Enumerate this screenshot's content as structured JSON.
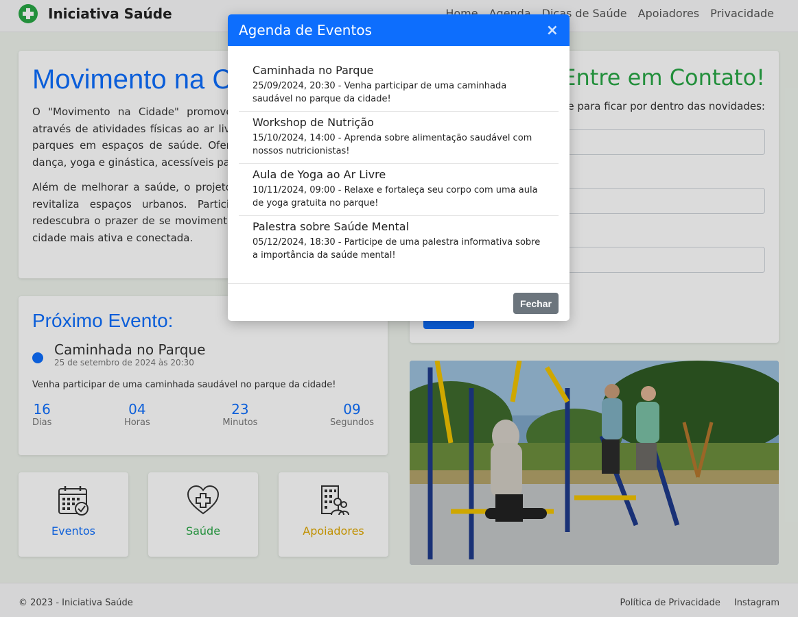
{
  "navbar": {
    "brand": "Iniciativa Saúde",
    "links": [
      "Home",
      "Agenda",
      "Dicas de Saúde",
      "Apoiadores",
      "Privacidade"
    ]
  },
  "about": {
    "title": "Movimento na Cidade",
    "paragraph1": "O \"Movimento na Cidade\" promove a saúde e o bem-estar através de atividades físicas ao ar livre, transformando praças e parques em espaços de saúde. Oferecemos aulas gratuitas de dança, yoga e ginástica, acessíveis para todas as idades.",
    "paragraph2": "Além de melhorar a saúde, o projeto fortalece a comunidade e revitaliza espaços urbanos. Participe, traga sua família e redescubra o prazer de se movimentar! Juntos, vamos criar uma cidade mais ativa e conectada."
  },
  "contact": {
    "title": "Entre em Contato!",
    "lead": "Cadastre-se para ficar por dentro das novidades:"
  },
  "next_event": {
    "heading": "Próximo Evento:",
    "title": "Caminhada no Parque",
    "date": "25 de setembro de 2024 às 20:30",
    "description": "Venha participar de uma caminhada saudável no parque da cidade!",
    "countdown": [
      {
        "value": "16",
        "label": "Dias"
      },
      {
        "value": "04",
        "label": "Horas"
      },
      {
        "value": "23",
        "label": "Minutos"
      },
      {
        "value": "09",
        "label": "Segundos"
      }
    ]
  },
  "tiles": [
    {
      "label": "Eventos",
      "icon": "calendar-check-icon",
      "color": "#0d6efd"
    },
    {
      "label": "Saúde",
      "icon": "heart-plus-icon",
      "color": "#28a745"
    },
    {
      "label": "Apoiadores",
      "icon": "building-people-icon",
      "color": "#e0a800"
    }
  ],
  "footer": {
    "copyright": "© 2023 - Iniciativa Saúde",
    "links": [
      "Política de Privacidade",
      "Instagram"
    ]
  },
  "modal": {
    "title": "Agenda de Eventos",
    "close_icon": "×",
    "events": [
      {
        "title": "Caminhada no Parque",
        "text": "25/09/2024, 20:30 - Venha participar de uma caminhada saudável no parque da cidade!"
      },
      {
        "title": "Workshop de Nutrição",
        "text": "15/10/2024, 14:00 - Aprenda sobre alimentação saudável com nossos nutricionistas!"
      },
      {
        "title": "Aula de Yoga ao Ar Livre",
        "text": "10/11/2024, 09:00 - Relaxe e fortaleça seu corpo com uma aula de yoga gratuita no parque!"
      },
      {
        "title": "Palestra sobre Saúde Mental",
        "text": "05/12/2024, 18:30 - Participe de uma palestra informativa sobre a importância da saúde mental!"
      }
    ],
    "close_button": "Fechar"
  },
  "colors": {
    "primary": "#0d6efd",
    "success": "#28a745",
    "warning": "#e0a800",
    "secondary": "#6c757d"
  }
}
